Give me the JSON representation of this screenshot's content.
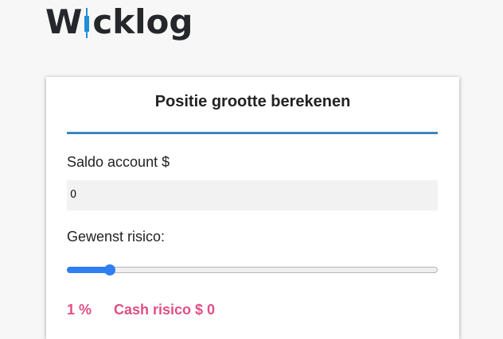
{
  "brand": {
    "name_before_candle": "W",
    "name_after_candle": "cklog",
    "candle_color": "#1f8fd6"
  },
  "card": {
    "title": "Positie grootte berekenen",
    "balance_label": "Saldo account $",
    "balance_value": "0",
    "risk_label": "Gewenst risico:",
    "risk_slider_value_percent": 1,
    "risk_percent_text": "1 %",
    "cash_risk_text": "Cash risico $ 0"
  },
  "colors": {
    "accent": "#3b86c0",
    "slider": "#2f7ef2",
    "result": "#e04e86"
  }
}
